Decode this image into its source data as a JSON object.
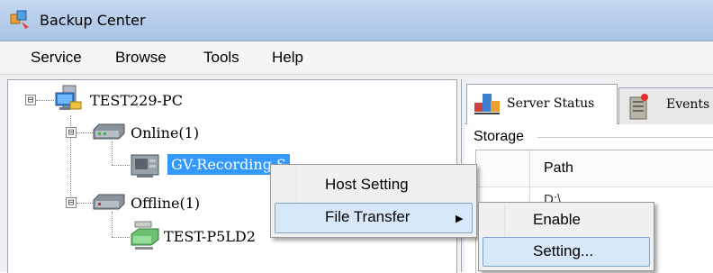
{
  "window": {
    "title": "Backup Center"
  },
  "menubar": {
    "items": [
      "Service",
      "Browse",
      "Tools",
      "Help"
    ]
  },
  "tree": {
    "root": "TEST229-PC",
    "online": "Online(1)",
    "online_child": "GV-Recording S",
    "offline": "Offline(1)",
    "offline_child": "TEST-P5LD2",
    "expanders": {
      "root": "⊟",
      "online": "⊟",
      "offline": "⊟"
    }
  },
  "tabs": {
    "server_status": "Server Status",
    "events": "Events"
  },
  "storage": {
    "group_label": "Storage",
    "columns": [
      "Path"
    ],
    "rows": [
      "D:\\"
    ]
  },
  "context_menu": {
    "items": [
      "Host Setting",
      "File Transfer"
    ],
    "submenu_arrow": "▶",
    "highlighted": "File Transfer"
  },
  "submenu": {
    "items": [
      "Enable",
      "Setting..."
    ],
    "highlighted": "Setting..."
  },
  "colors": {
    "selection": "#3399ff",
    "menu_highlight": "#d7e8f8",
    "titlebar": "#b7cde9"
  }
}
